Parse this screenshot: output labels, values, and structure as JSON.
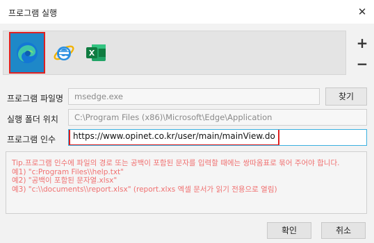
{
  "window": {
    "title": "프로그램 실행",
    "close_glyph": "✕"
  },
  "icons": [
    {
      "name": "edge-icon",
      "selected": true
    },
    {
      "name": "ie-icon",
      "selected": false
    },
    {
      "name": "excel-icon",
      "selected": false
    }
  ],
  "side_buttons": {
    "add": "+",
    "remove": "−"
  },
  "fields": {
    "file_name": {
      "label": "프로그램 파일명",
      "value": "msedge.exe"
    },
    "folder": {
      "label": "실행 폴더 위치",
      "value": "C:\\Program Files (x86)\\Microsoft\\Edge\\Application"
    },
    "args": {
      "label": "프로그램 인수",
      "value": "https://www.opinet.co.kr/user/main/mainView.do"
    }
  },
  "browse_label": "찾기",
  "tip_lines": [
    "Tip.프로그램 인수에 파일의 경로 또는 공백이 포함된 문자를 입력할 때에는 쌍따옴표로 묶어 주어야 합니다.",
    "예1) \"c:Program Files\\\\help.txt\"",
    "예2) \"공백이 포함된 문자열.xlsx\"",
    "예3) \"c:\\\\documents\\\\report.xlsx\" (report.xlxs 엑셀 문서가 읽기 전용으로 열림)"
  ],
  "buttons": {
    "ok": "확인",
    "cancel": "취소"
  },
  "colors": {
    "highlight": "#e02020",
    "tip_text": "#f07070",
    "active_border": "#3ab0e0"
  }
}
